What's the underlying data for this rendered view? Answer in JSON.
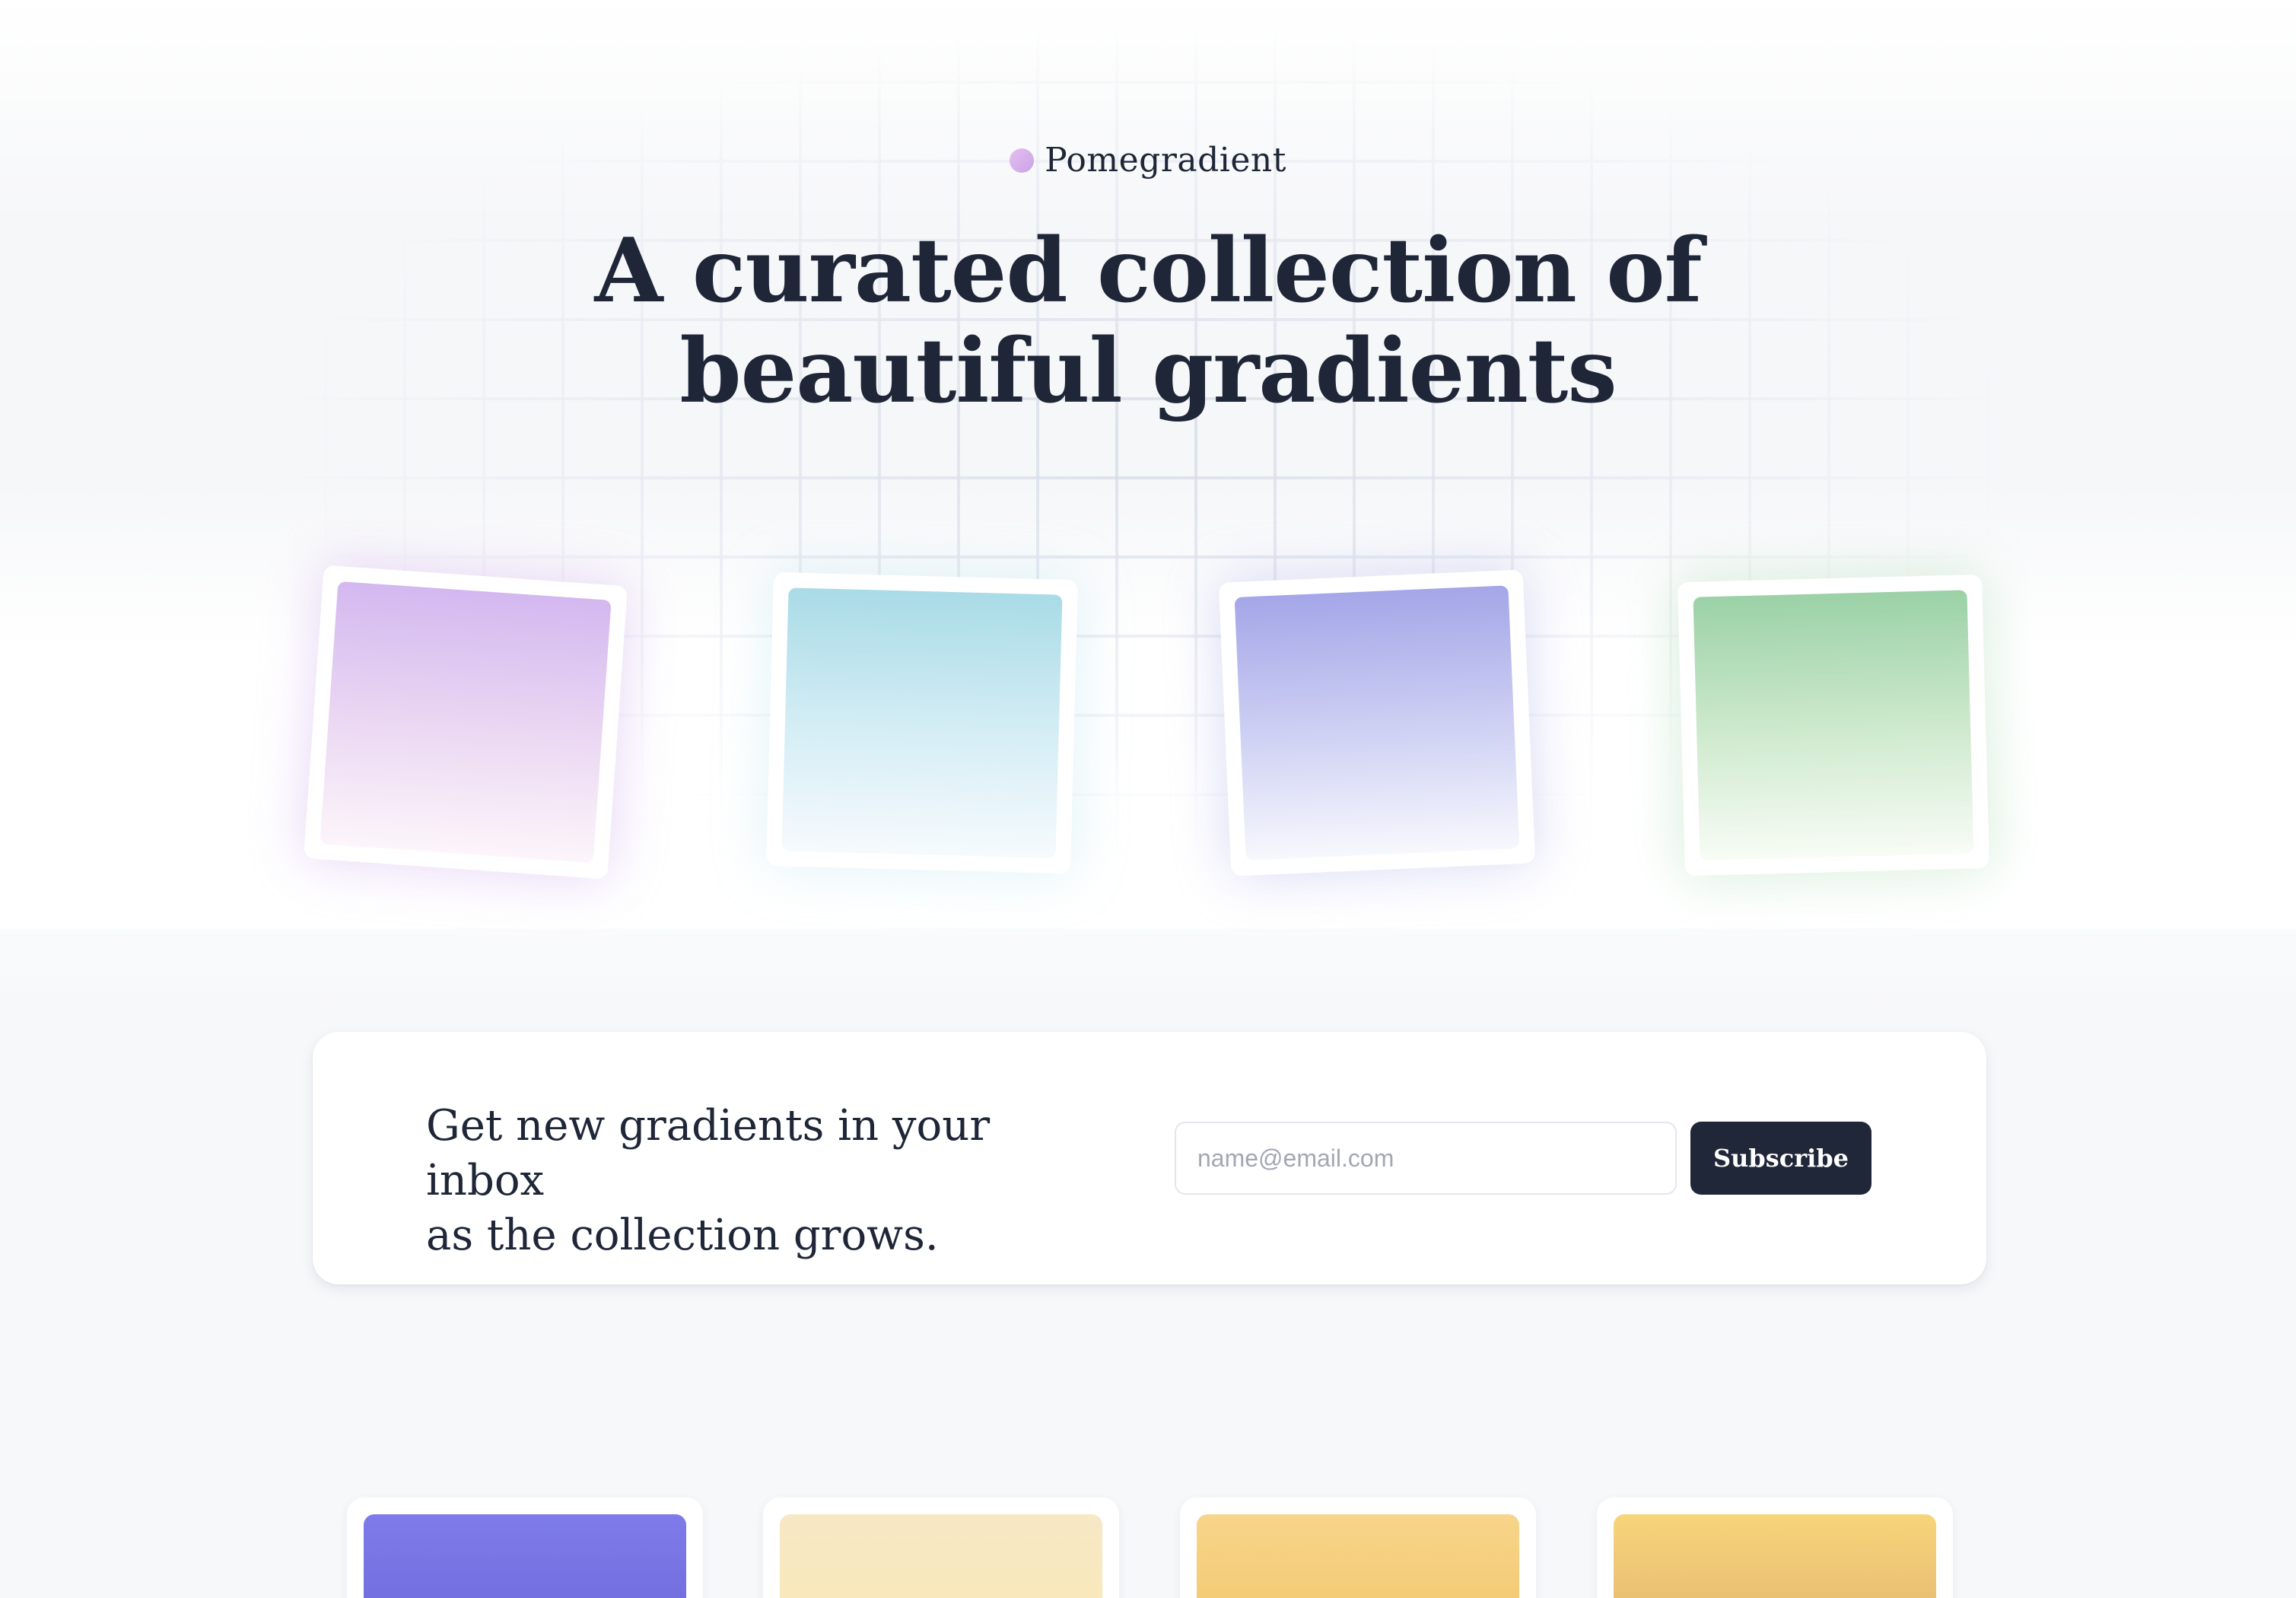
{
  "brand": {
    "name": "Pomegradient",
    "dot_color": "#d2aef0"
  },
  "hero": {
    "headline_line1": "A curated collection of",
    "headline_line2": "beautiful gradients",
    "featured_gradients": [
      {
        "from": "#d3b8f0",
        "to": "#fcf5fa"
      },
      {
        "from": "#a9dbe6",
        "to": "#f6fafd"
      },
      {
        "from": "#a4a6e8",
        "to": "#f7f8fd"
      },
      {
        "from": "#9bd1a6",
        "to": "#f8fcf6"
      }
    ]
  },
  "subscribe": {
    "text_line1": "Get new gradients in your inbox",
    "text_line2": "as the collection grows.",
    "email_placeholder": "name@email.com",
    "email_value": "",
    "button_label": "Subscribe",
    "button_color": "#1f2739"
  },
  "gallery": {
    "gradients": [
      {
        "from": "#7e7bea",
        "to": "#6a66d8"
      },
      {
        "from": "#f7e8c6",
        "to": "#fae9b2"
      },
      {
        "from": "#f7d58a",
        "to": "#f1c468"
      },
      {
        "from": "#f7d57a",
        "to": "#e0ae6e"
      }
    ]
  },
  "colors": {
    "text_primary": "#1e2638",
    "page_background": "#f7f8fa",
    "card_background": "#ffffff"
  }
}
